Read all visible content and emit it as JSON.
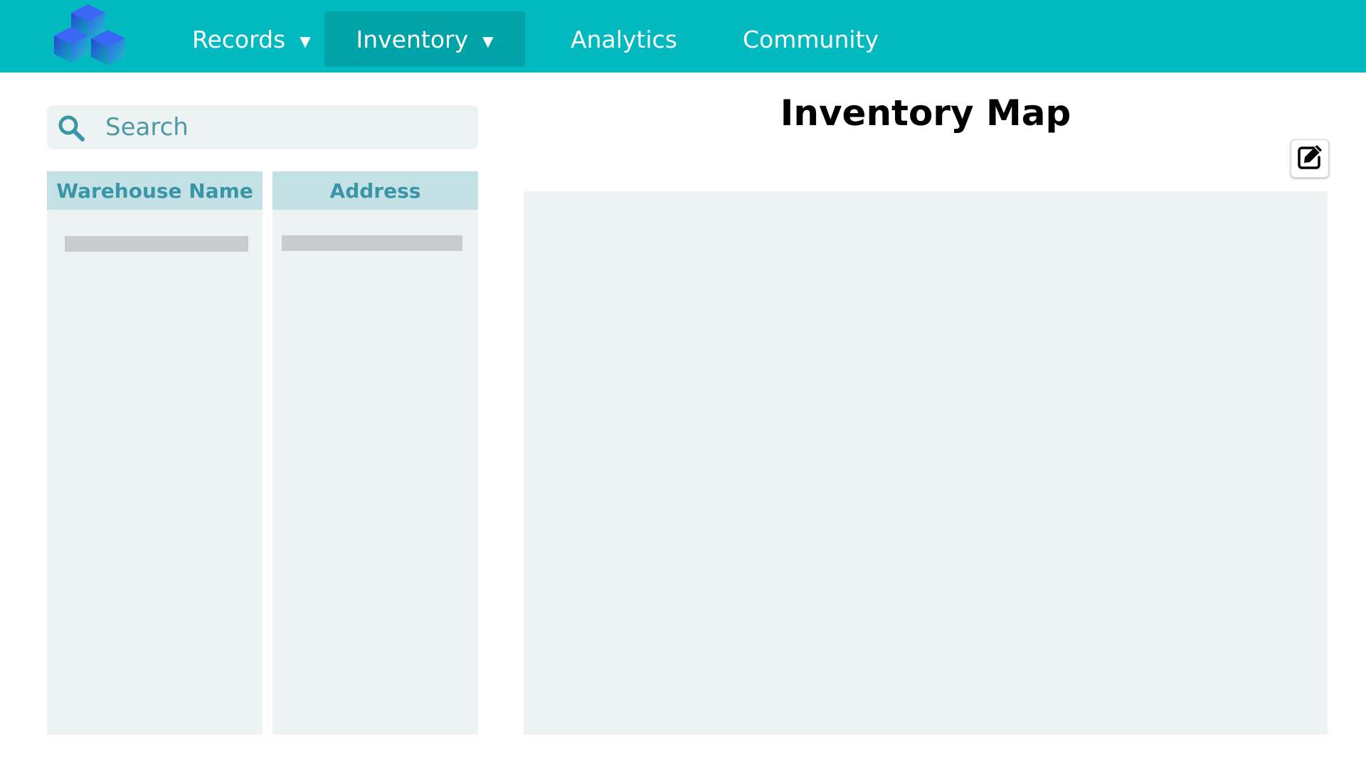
{
  "nav": {
    "items": [
      {
        "label": "Records",
        "caret": "▼"
      },
      {
        "label": "Inventory",
        "caret": "▼"
      },
      {
        "label": "Analytics"
      },
      {
        "label": "Community"
      }
    ],
    "active": "Inventory",
    "color": "#00bac0"
  },
  "search": {
    "placeholder": "Search"
  },
  "table": {
    "columns": [
      "Warehouse Name",
      "Address"
    ]
  },
  "main": {
    "title": "Inventory Map"
  },
  "icons": {
    "logo": "stacked-boxes-logo",
    "search": "search-icon",
    "edit": "edit-icon"
  }
}
